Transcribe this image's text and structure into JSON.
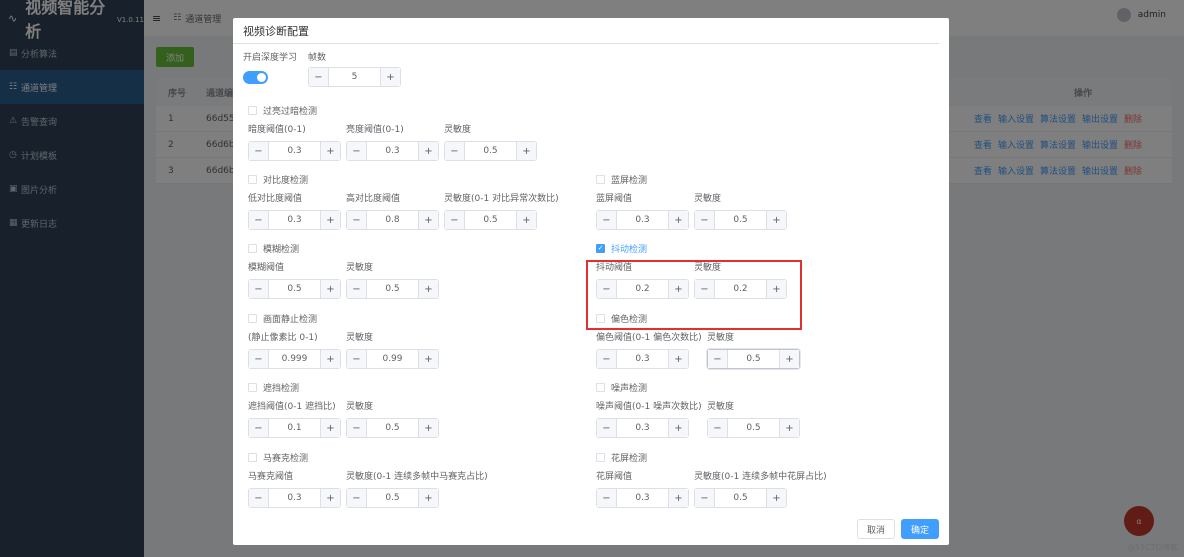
{
  "app": {
    "title": "视频智能分析",
    "version": "V1.0.11",
    "user": "admin"
  },
  "sidebar": {
    "items": [
      {
        "label": "分析算法",
        "icon": "algorithm-icon"
      },
      {
        "label": "通道管理",
        "icon": "channel-icon",
        "active": true
      },
      {
        "label": "告警查询",
        "icon": "alarm-icon"
      },
      {
        "label": "计划模板",
        "icon": "clock-icon"
      },
      {
        "label": "图片分析",
        "icon": "image-icon"
      },
      {
        "label": "更新日志",
        "icon": "log-icon"
      }
    ]
  },
  "breadcrumb": "通道管理",
  "page": {
    "add_label": "添加",
    "headers": {
      "idx": "序号",
      "code": "通道编",
      "ops": "操作"
    },
    "rows": [
      {
        "idx": "1",
        "code": "66d55"
      },
      {
        "idx": "2",
        "code": "66d6b"
      },
      {
        "idx": "3",
        "code": "66d6b"
      }
    ],
    "ops": [
      "查看",
      "输入设置",
      "算法设置",
      "输出设置",
      "删除"
    ]
  },
  "dialog": {
    "title": "视频诊断配置",
    "deep_learning_label": "开启深度学习",
    "deep_learning_on": true,
    "frames_label": "帧数",
    "frames_value": "5",
    "sections": {
      "brightness": {
        "label": "过亮过暗检测",
        "checked": false,
        "fields": [
          {
            "label": "暗度阈值(0-1)",
            "value": "0.3"
          },
          {
            "label": "亮度阈值(0-1)",
            "value": "0.3"
          },
          {
            "label": "灵敏度",
            "value": "0.5"
          }
        ]
      },
      "contrast": {
        "label": "对比度检测",
        "checked": false,
        "fields": [
          {
            "label": "低对比度阈值",
            "value": "0.3"
          },
          {
            "label": "高对比度阈值",
            "value": "0.8"
          },
          {
            "label": "灵敏度(0-1 对比异常次数比)",
            "value": "0.5"
          }
        ]
      },
      "bluescreen": {
        "label": "蓝屏检测",
        "checked": false,
        "fields": [
          {
            "label": "蓝屏阈值",
            "value": "0.3"
          },
          {
            "label": "灵敏度",
            "value": "0.5"
          }
        ]
      },
      "blur": {
        "label": "模糊检测",
        "checked": false,
        "fields": [
          {
            "label": "模糊阈值",
            "value": "0.5"
          },
          {
            "label": "灵敏度",
            "value": "0.5"
          }
        ]
      },
      "shake": {
        "label": "抖动检测",
        "checked": true,
        "fields": [
          {
            "label": "抖动阈值",
            "value": "0.2"
          },
          {
            "label": "灵敏度",
            "value": "0.2"
          }
        ]
      },
      "frozen": {
        "label": "画面静止检测",
        "checked": false,
        "fields": [
          {
            "label": "(静止像素比 0-1)",
            "value": "0.999"
          },
          {
            "label": "灵敏度",
            "value": "0.99"
          }
        ]
      },
      "colorcast": {
        "label": "偏色检测",
        "checked": false,
        "fields": [
          {
            "label": "偏色阈值(0-1 偏色次数比)",
            "value": "0.3"
          },
          {
            "label": "灵敏度",
            "value": "0.5"
          }
        ]
      },
      "occlusion": {
        "label": "遮挡检测",
        "checked": false,
        "fields": [
          {
            "label": "遮挡阈值(0-1 遮挡比)",
            "value": "0.1"
          },
          {
            "label": "灵敏度",
            "value": "0.5"
          }
        ]
      },
      "noise": {
        "label": "噪声检测",
        "checked": false,
        "fields": [
          {
            "label": "噪声阈值(0-1 噪声次数比)",
            "value": "0.3"
          },
          {
            "label": "灵敏度",
            "value": "0.5"
          }
        ]
      },
      "mosaic": {
        "label": "马赛克检测",
        "checked": false,
        "fields": [
          {
            "label": "马赛克阈值",
            "value": "0.3"
          },
          {
            "label": "灵敏度(0-1 连续多帧中马赛克占比)",
            "value": "0.5"
          }
        ]
      },
      "glitch": {
        "label": "花屏检测",
        "checked": false,
        "fields": [
          {
            "label": "花屏阈值",
            "value": "0.3"
          },
          {
            "label": "灵敏度(0-1 连续多帧中花屏占比)",
            "value": "0.5"
          }
        ]
      }
    },
    "cancel_label": "取消",
    "confirm_label": "确定"
  },
  "watermark": "@51CTO博客",
  "fab_label": "α"
}
